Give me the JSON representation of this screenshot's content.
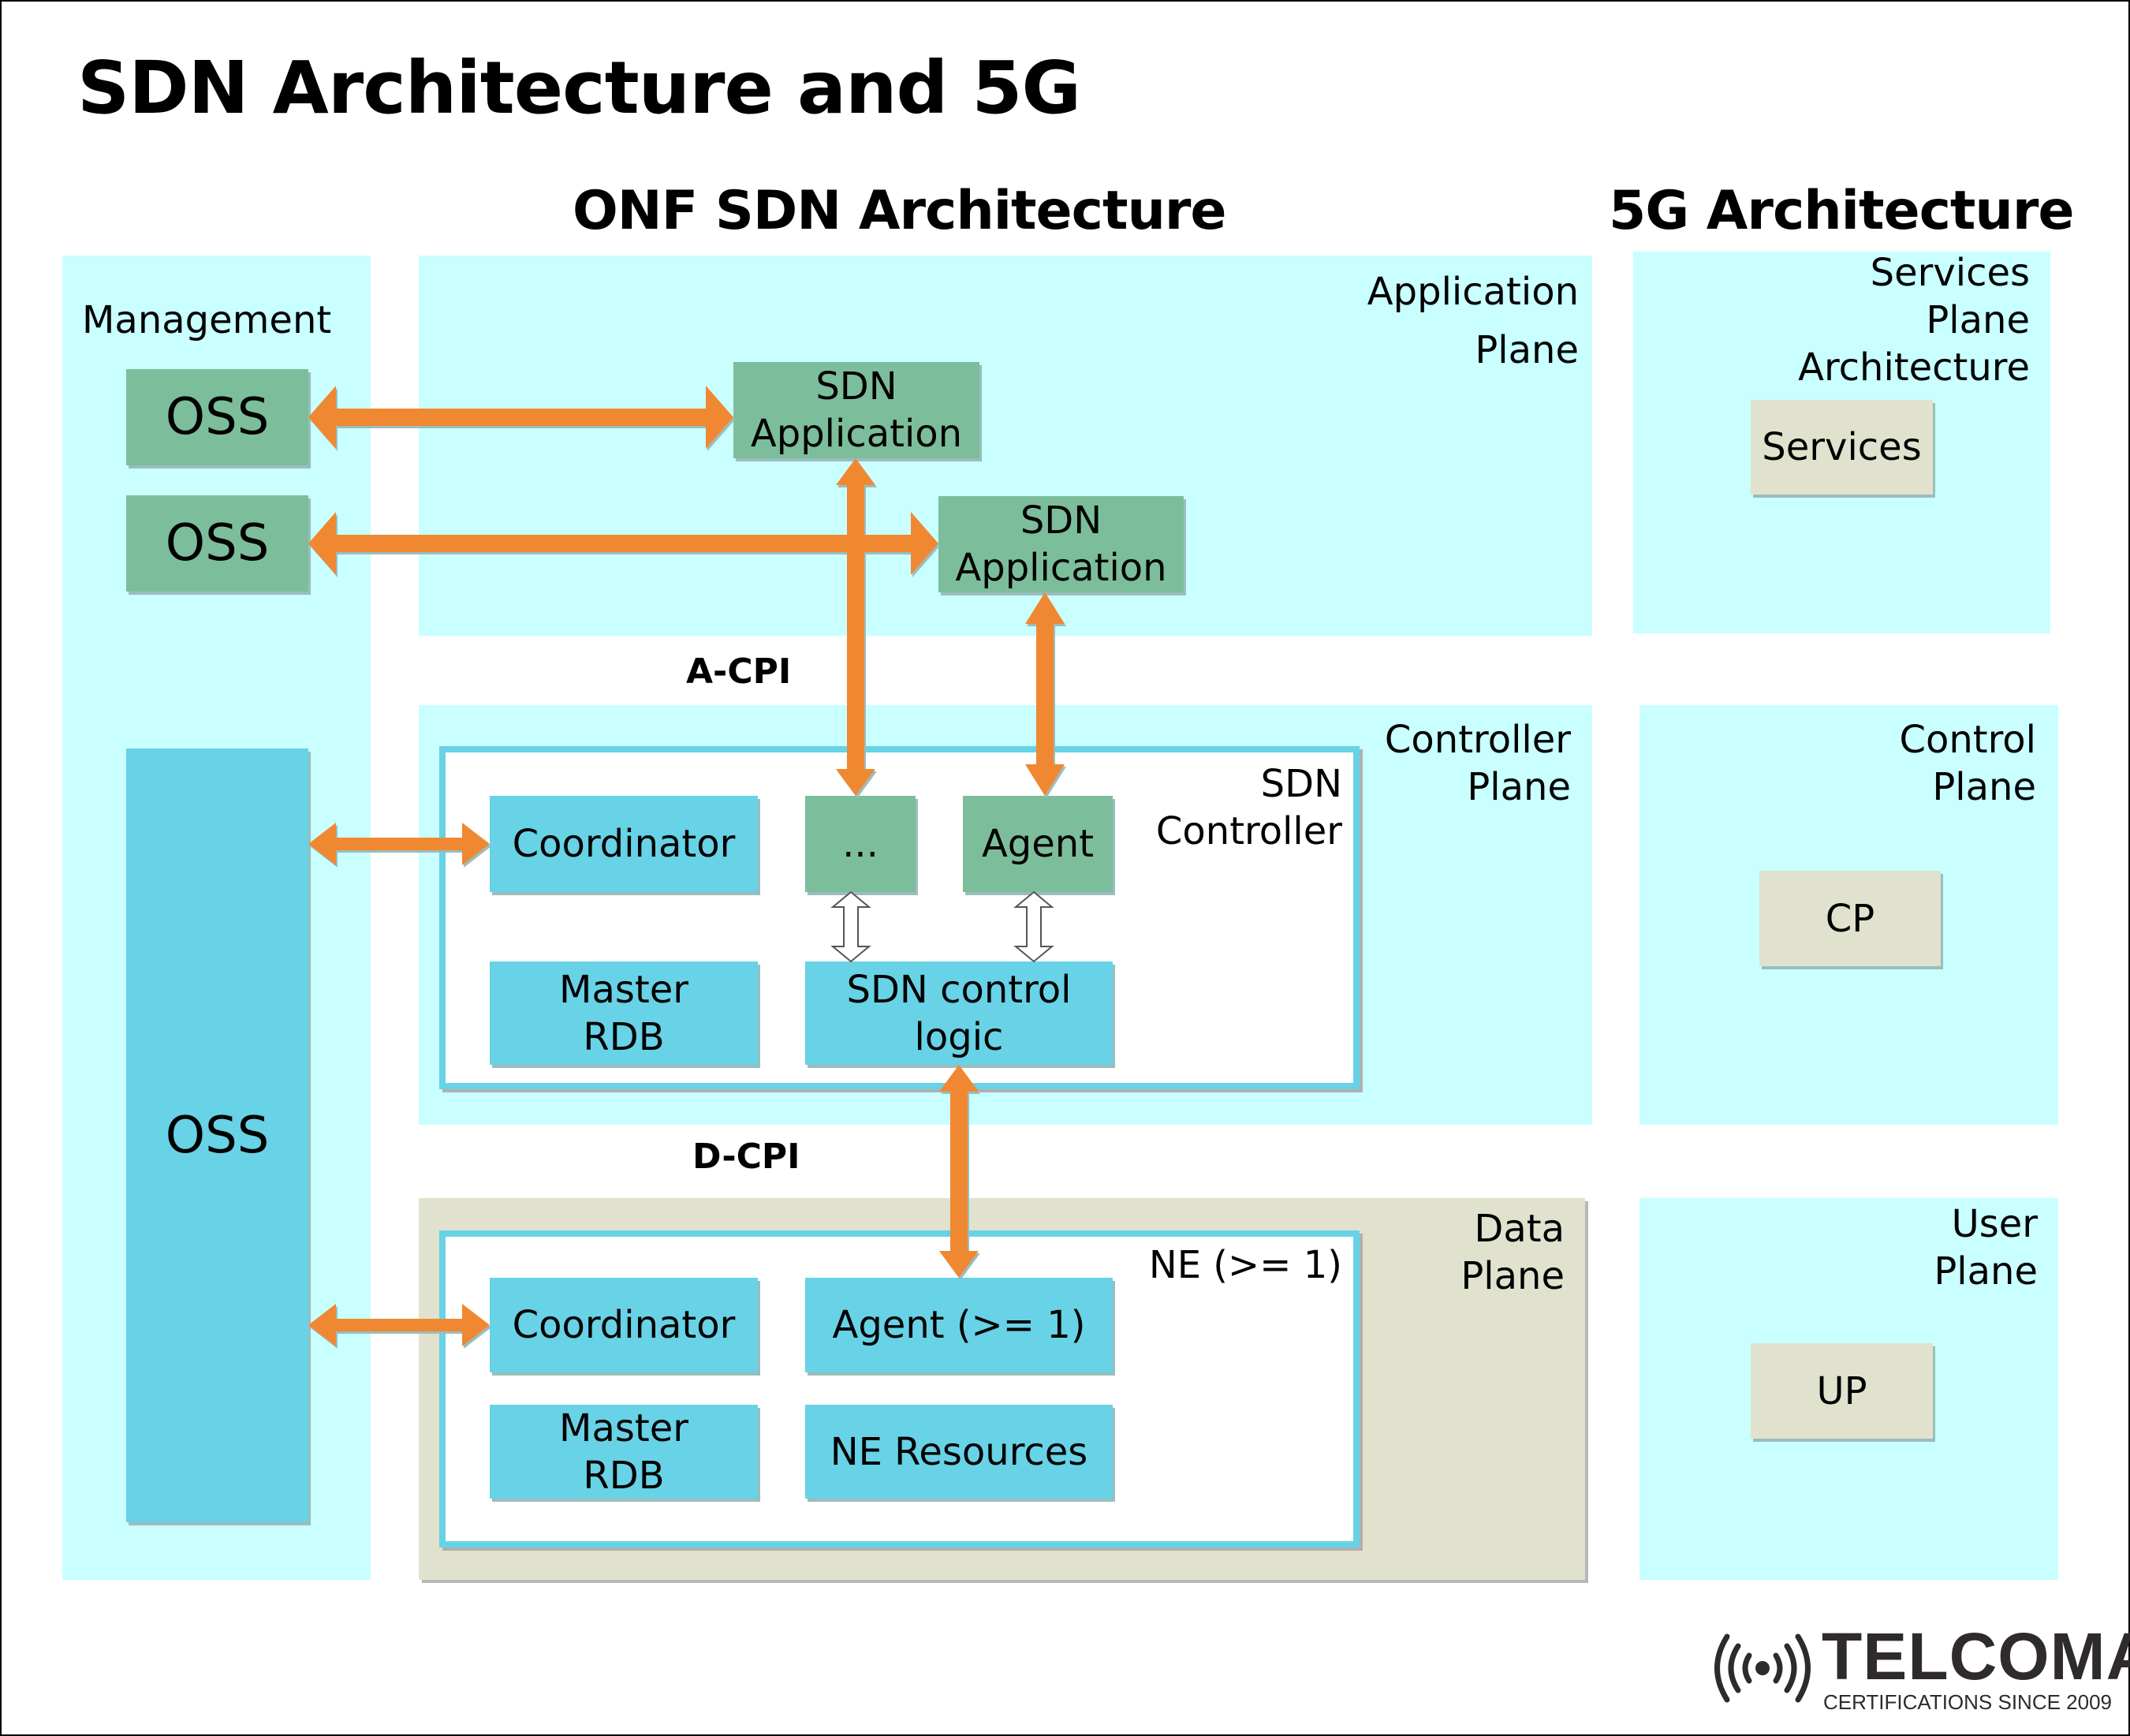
{
  "title": "SDN Architecture and 5G",
  "onf": {
    "heading": "ONF SDN Architecture",
    "management": {
      "label": "Management",
      "oss_top": "OSS",
      "oss_mid": "OSS",
      "oss_big": "OSS"
    },
    "application_plane": {
      "label_line1": "Application",
      "label_line2": "Plane",
      "apps": [
        {
          "line1": "SDN",
          "line2": "Application"
        },
        {
          "line1": "SDN",
          "line2": "Application"
        }
      ]
    },
    "a_cpi": "A-CPI",
    "controller_plane": {
      "label_line1": "Controller",
      "label_line2": "Plane",
      "controller": {
        "label_line1": "SDN",
        "label_line2": "Controller",
        "coordinator": "Coordinator",
        "ellipsis": "...",
        "agent": "Agent",
        "master_rdb_line1": "Master",
        "master_rdb_line2": "RDB",
        "control_logic_line1": "SDN control",
        "control_logic_line2": "logic"
      }
    },
    "d_cpi": "D-CPI",
    "data_plane": {
      "label_line1": "Data",
      "label_line2": "Plane",
      "ne": {
        "label": "NE (>= 1)",
        "coordinator": "Coordinator",
        "agent": "Agent (>= 1)",
        "master_rdb_line1": "Master",
        "master_rdb_line2": "RDB",
        "resources": "NE Resources"
      }
    }
  },
  "fiveg": {
    "heading": "5G Architecture",
    "services_plane": {
      "label_line1": "Services",
      "label_line2": "Plane",
      "label_line3": "Architecture",
      "box": "Services"
    },
    "control_plane": {
      "label_line1": "Control",
      "label_line2": "Plane",
      "box": "CP"
    },
    "user_plane": {
      "label_line1": "User",
      "label_line2": "Plane",
      "box": "UP"
    }
  },
  "logo": {
    "name": "TELCOMA",
    "tagline": "CERTIFICATIONS SINCE 2009"
  },
  "colors": {
    "panel": "#c9ffff",
    "data_plane": "#e0e2cd",
    "green_box": "#7cbe9b",
    "cyan_box": "#68d2e6",
    "arrow": "#f08833"
  }
}
